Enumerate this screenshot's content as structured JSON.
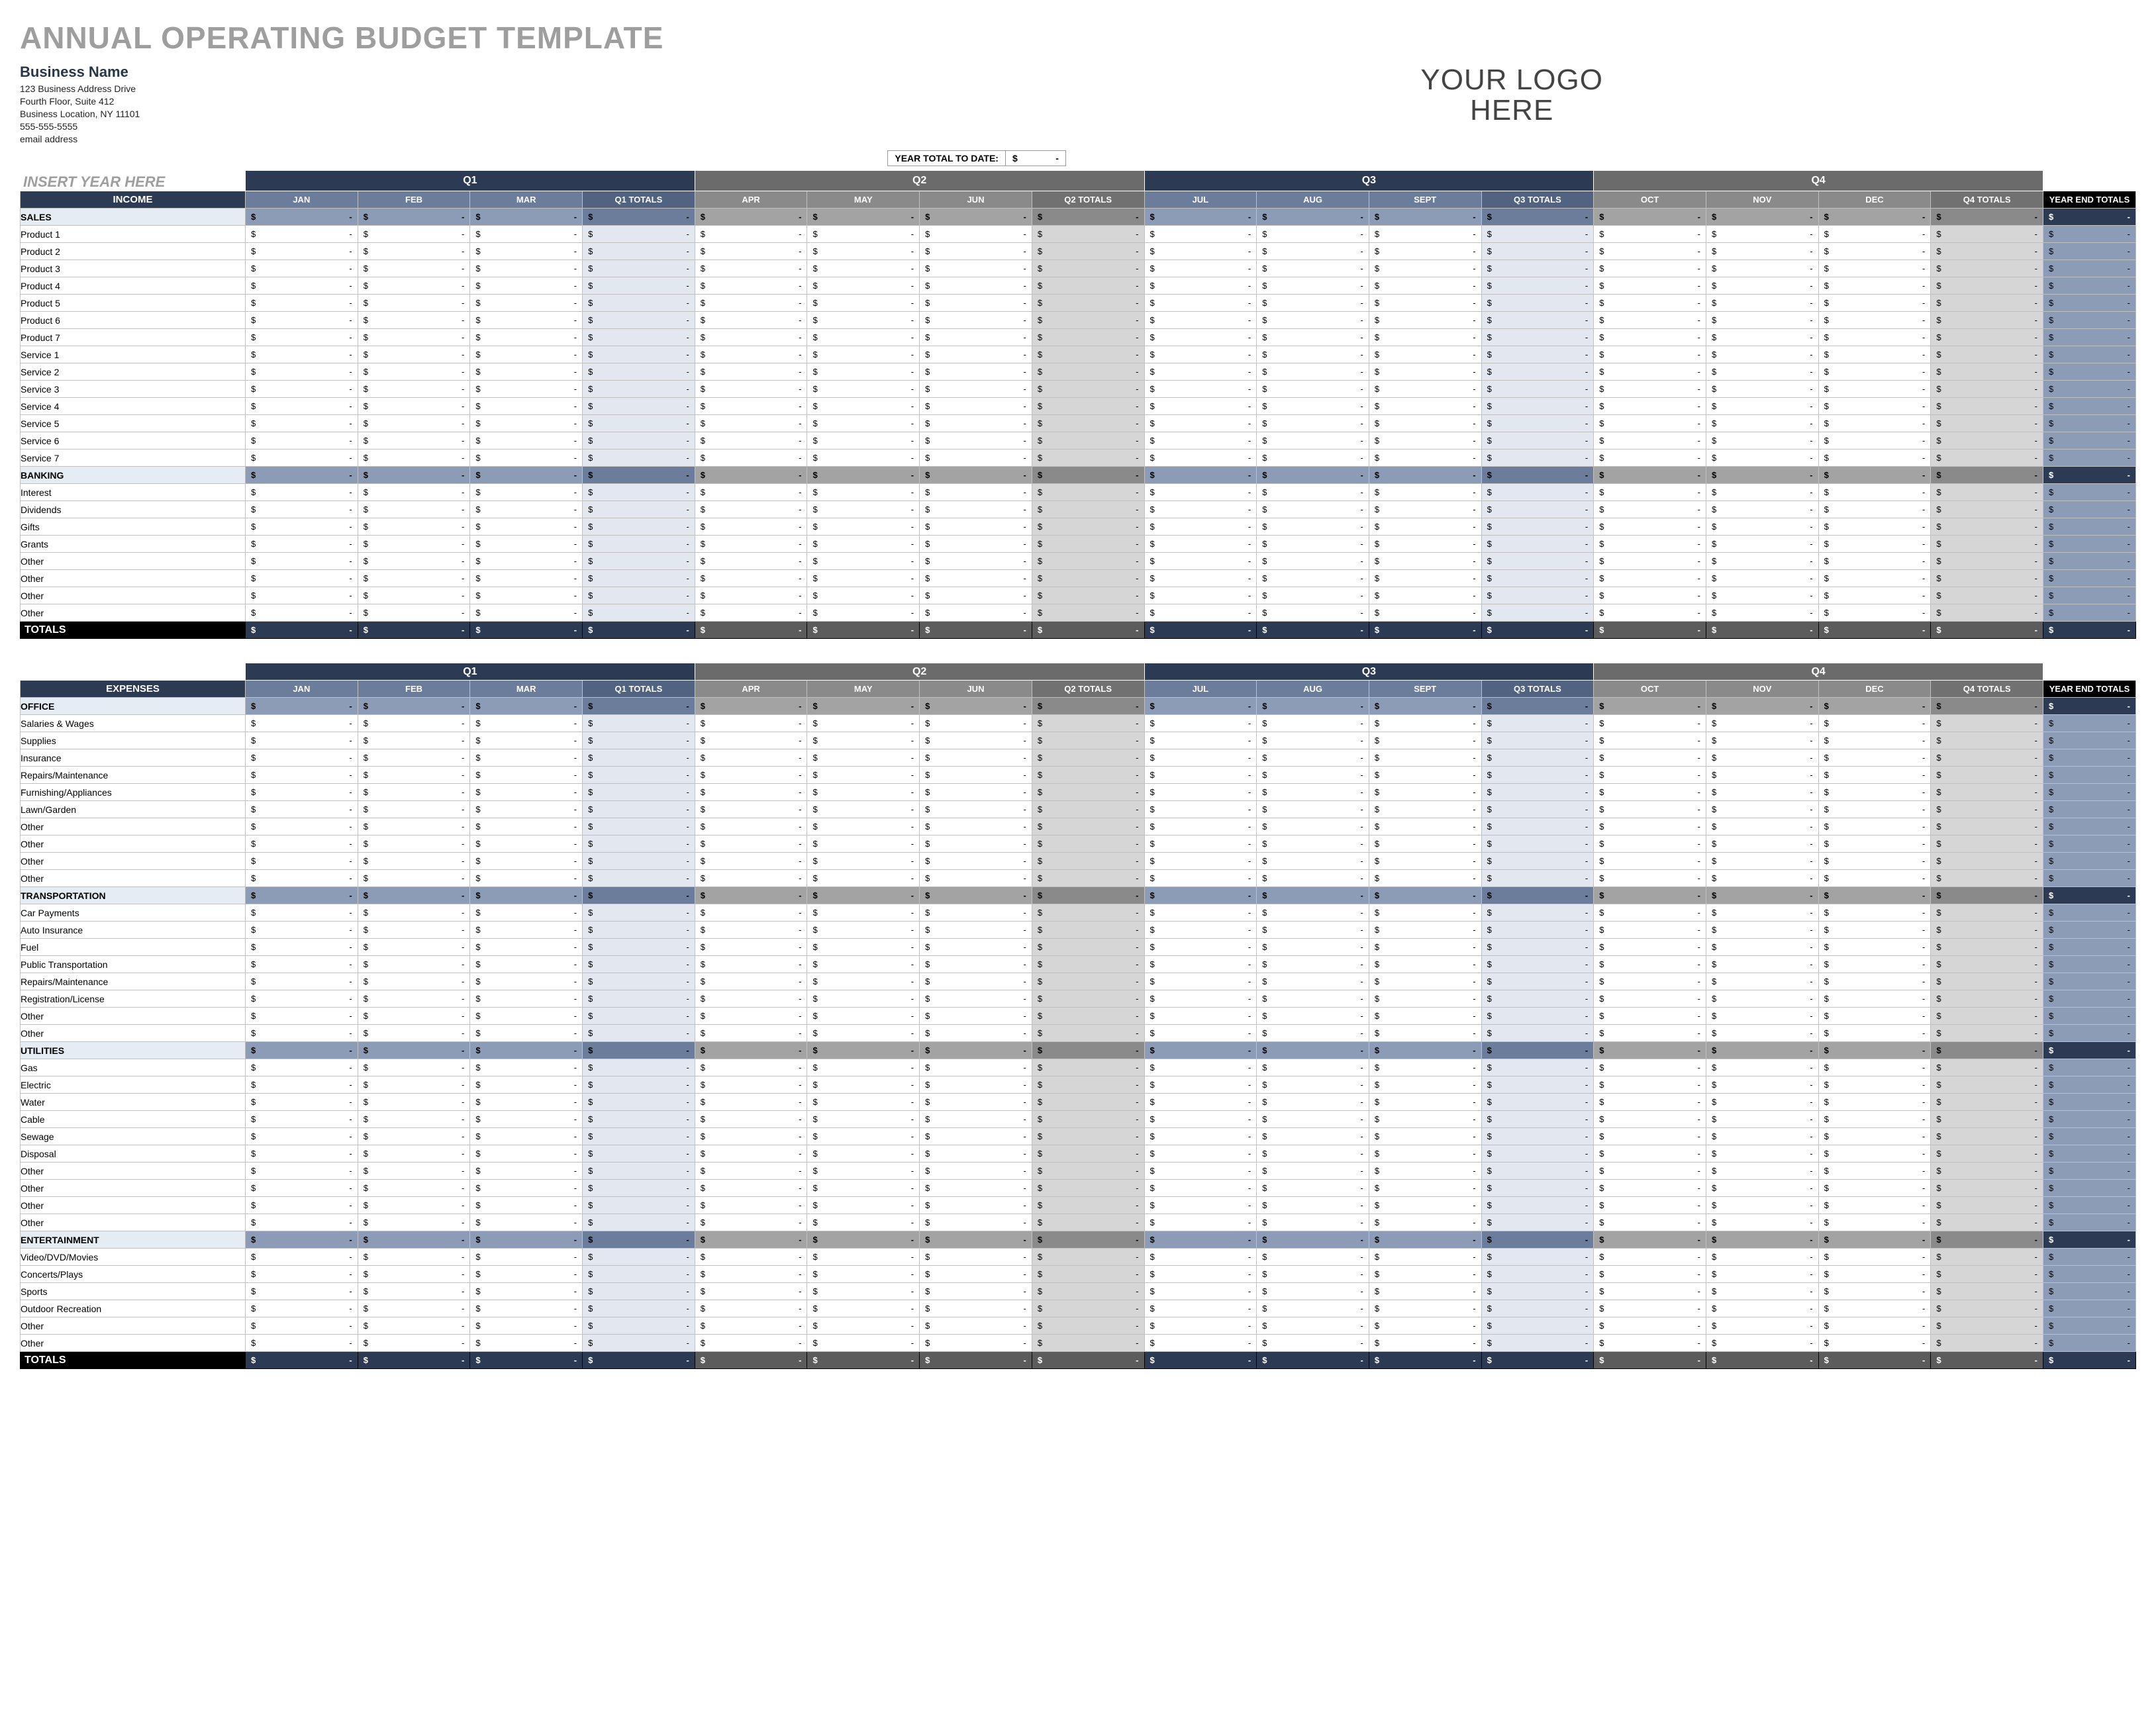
{
  "title": "ANNUAL OPERATING BUDGET TEMPLATE",
  "business": {
    "name": "Business Name",
    "lines": [
      "123 Business Address Drive",
      "Fourth Floor, Suite 412",
      "Business Location, NY  11101",
      "555-555-5555",
      "email address"
    ]
  },
  "logo": {
    "line1": "YOUR LOGO",
    "line2": "HERE"
  },
  "year_placeholder": "INSERT YEAR HERE",
  "ytd": {
    "label": "YEAR TOTAL TO DATE:",
    "currency": "$",
    "value": "-"
  },
  "quarters": [
    {
      "label": "Q1",
      "months": [
        "JAN",
        "FEB",
        "MAR"
      ],
      "total": "Q1 TOTALS"
    },
    {
      "label": "Q2",
      "months": [
        "APR",
        "MAY",
        "JUN"
      ],
      "total": "Q2 TOTALS"
    },
    {
      "label": "Q3",
      "months": [
        "JUL",
        "AUG",
        "SEPT"
      ],
      "total": "Q3 TOTALS"
    },
    {
      "label": "Q4",
      "months": [
        "OCT",
        "NOV",
        "DEC"
      ],
      "total": "Q4 TOTALS"
    }
  ],
  "year_end_label": "YEAR END TOTALS",
  "totals_label": "TOTALS",
  "currency": "$",
  "dash": "-",
  "income": {
    "section": "INCOME",
    "groups": [
      {
        "name": "SALES",
        "items": [
          "Product 1",
          "Product 2",
          "Product 3",
          "Product 4",
          "Product 5",
          "Product 6",
          "Product 7",
          "Service 1",
          "Service 2",
          "Service 3",
          "Service 4",
          "Service 5",
          "Service 6",
          "Service 7"
        ]
      },
      {
        "name": "BANKING",
        "items": [
          "Interest",
          "Dividends",
          "Gifts",
          "Grants",
          "Other",
          "Other",
          "Other",
          "Other"
        ]
      }
    ]
  },
  "expenses": {
    "section": "EXPENSES",
    "groups": [
      {
        "name": "OFFICE",
        "items": [
          "Salaries & Wages",
          "Supplies",
          "Insurance",
          "Repairs/Maintenance",
          "Furnishing/Appliances",
          "Lawn/Garden",
          "Other",
          "Other",
          "Other",
          "Other"
        ]
      },
      {
        "name": "TRANSPORTATION",
        "items": [
          "Car Payments",
          "Auto Insurance",
          "Fuel",
          "Public Transportation",
          "Repairs/Maintenance",
          "Registration/License",
          "Other",
          "Other"
        ]
      },
      {
        "name": "UTILITIES",
        "items": [
          "Gas",
          "Electric",
          "Water",
          "Cable",
          "Sewage",
          "Disposal",
          "Other",
          "Other",
          "Other",
          "Other"
        ]
      },
      {
        "name": "ENTERTAINMENT",
        "items": [
          "Video/DVD/Movies",
          "Concerts/Plays",
          "Sports",
          "Outdoor Recreation",
          "Other",
          "Other"
        ]
      }
    ]
  }
}
